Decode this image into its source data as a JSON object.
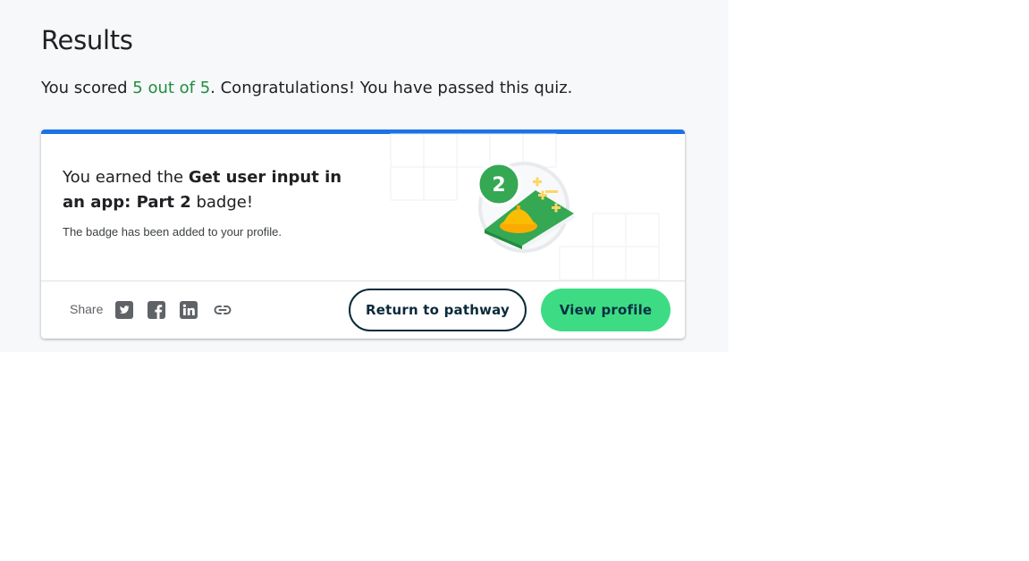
{
  "results": {
    "title": "Results",
    "score_prefix": "You scored ",
    "score_value": "5 out of 5",
    "score_suffix": ". Congratulations! You have passed this quiz."
  },
  "badge_card": {
    "earned_prefix": "You earned the ",
    "badge_name": "Get user input in an app: Part 2",
    "earned_suffix": " badge!",
    "note": "The badge has been added to your profile.",
    "badge_number": "2",
    "accent_color": "#1a73e8"
  },
  "share": {
    "label": "Share",
    "icons": [
      "twitter-icon",
      "facebook-icon",
      "linkedin-icon",
      "link-icon"
    ]
  },
  "actions": {
    "return_label": "Return to pathway",
    "view_profile_label": "View profile",
    "view_profile_color": "#3ddc84"
  }
}
